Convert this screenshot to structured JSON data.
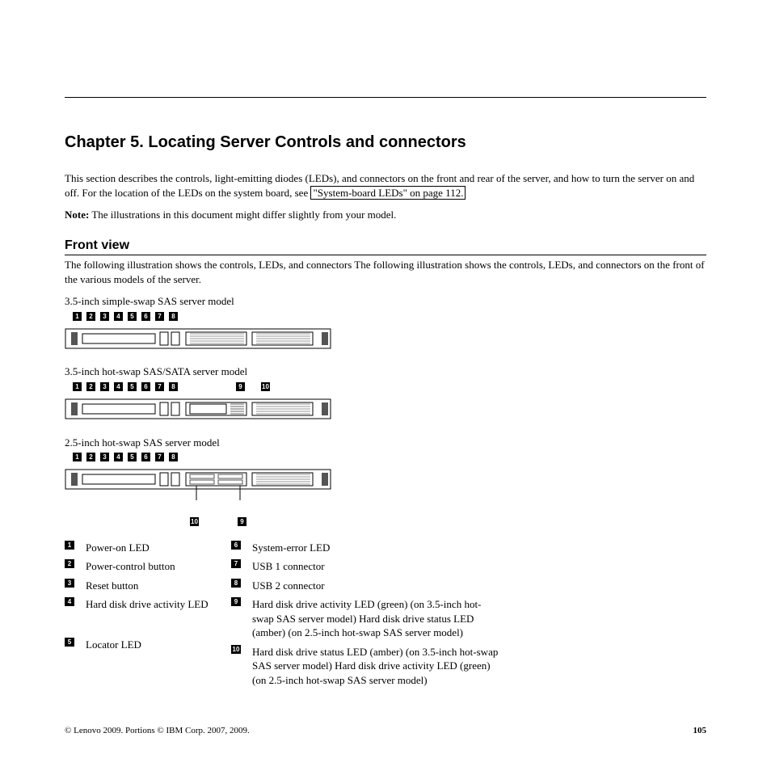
{
  "chapterTitle": "Chapter 5. Locating Server Controls and connectors",
  "intro1": "This section describes the controls, light-emitting diodes (LEDs), and connectors on the front and rear of the server, and how to turn the server on and off. For the location of the LEDs on the system board, see ",
  "introLink": "\"System-board LEDs\" on page 112.",
  "noteLabel": "Note:",
  "noteBody": " The illustrations in this document might differ slightly from your model.",
  "sectionTitle": "Front view",
  "sectionIntro": "The following illustration shows the controls, LEDs, and connectors The following illustration shows the controls, LEDs, and connectors on the front of the various models of the server.",
  "models": [
    {
      "caption": "3.5-inch simple-swap SAS server model",
      "callouts": [
        "1",
        "2",
        "3",
        "4",
        "5",
        "6",
        "7",
        "8"
      ]
    },
    {
      "caption": "3.5-inch hot-swap SAS/SATA server model",
      "callouts": [
        "1",
        "2",
        "3",
        "4",
        "5",
        "6",
        "7",
        "8"
      ],
      "callouts2": [
        "9",
        "10"
      ]
    },
    {
      "caption": "2.5-inch hot-swap SAS server model",
      "callouts": [
        "1",
        "2",
        "3",
        "4",
        "5",
        "6",
        "7",
        "8"
      ],
      "calloutsBelow": [
        "10",
        "9"
      ]
    }
  ],
  "legend": {
    "left": [
      {
        "n": "1",
        "t": "Power-on LED"
      },
      {
        "n": "2",
        "t": "Power-control button"
      },
      {
        "n": "3",
        "t": "Reset button"
      },
      {
        "n": "4",
        "t": "Hard disk drive activity LED"
      },
      {
        "n": "5",
        "t": "Locator LED"
      }
    ],
    "right": [
      {
        "n": "6",
        "t": "System-error LED"
      },
      {
        "n": "7",
        "t": "USB 1 connector"
      },
      {
        "n": "8",
        "t": "USB 2 connector"
      },
      {
        "n": "9",
        "t": "Hard disk drive activity LED (green) (on 3.5-inch hot-swap SAS server model) Hard disk drive status LED (amber) (on 2.5-inch hot-swap SAS server model)"
      },
      {
        "n": "10",
        "t": "Hard disk drive status LED (amber) (on 3.5-inch hot-swap SAS server model) Hard disk drive activity LED (green) (on 2.5-inch hot-swap SAS server model)"
      }
    ]
  },
  "footerLeft": "© Lenovo 2009. Portions © IBM Corp. 2007, 2009.",
  "footerRight": "105"
}
